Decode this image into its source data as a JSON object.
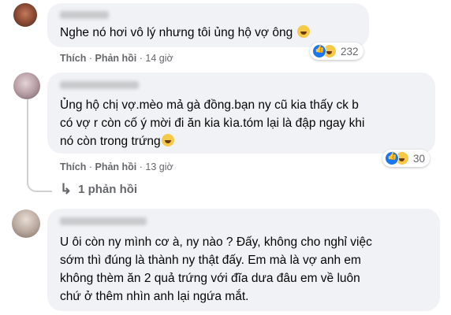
{
  "comments": [
    {
      "text": "Nghe nó hơi vô lý nhưng tôi ủng hộ vợ ông",
      "like_label": "Thích",
      "reply_label": "Phản hồi",
      "time": "14 giờ",
      "reaction_count": "232",
      "reactions": [
        "like-icon",
        "haha-icon"
      ]
    },
    {
      "lines": [
        "Ủng hộ chị vợ.mèo mả gà đồng.bạn ny cũ kia thấy ck b",
        "có vợ r còn cố ý mời đi ăn kia kìa.tóm lại là đập ngay khi",
        "nó còn trong trứng"
      ],
      "like_label": "Thích",
      "reply_label": "Phản hồi",
      "time": "13 giờ",
      "reaction_count": "30",
      "reactions": [
        "like-icon",
        "haha-icon"
      ],
      "replies_label": "1 phản hồi"
    },
    {
      "lines": [
        "U ôi còn ny mình cơ à, ny nào ? Đấy, không cho nghỉ việc",
        "sớm thì đúng là thành ny thật đấy. Em mà là vợ anh em",
        "không thèm ăn 2 quả trứng với đĩa dưa đâu em về luôn",
        "chứ ở thêm nhìn anh lại ngứa mắt."
      ]
    }
  ],
  "separator": "·",
  "colors": {
    "bubble": "#f0f2f5",
    "meta_text": "#65676b",
    "like_blue": "#1877f2",
    "haha_yellow": "#f7c948"
  }
}
